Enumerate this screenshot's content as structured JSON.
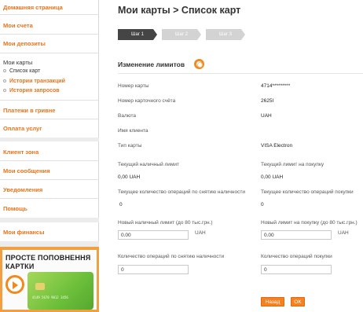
{
  "sidebar": {
    "home": "Домашняя страница",
    "accounts": "Мои счета",
    "deposits": "Мои депозиты",
    "cards_current": "Мои карты",
    "cards_sub": [
      "Список карт",
      "Истории транзакций",
      "История запросов"
    ],
    "payments": "Платежи в гривне",
    "services": "Оплата услуг",
    "client_zone": "Клиент зона",
    "messages": "Мои сообщения",
    "notifications": "Уведомления",
    "help": "Помощь",
    "finances": "Мои финансы"
  },
  "promo": {
    "title": "ПРОСТЕ ПОПОВНЕННЯ КАРТКИ",
    "card_number": "4149 5678 9012 3456"
  },
  "header": {
    "title": "Мои карты > Список карт",
    "steps": [
      "Шаг 1",
      "Шаг 2",
      "Шаг 3"
    ]
  },
  "section": {
    "title": "Изменение лимитов",
    "icon": "lifebuoy-icon"
  },
  "details": [
    {
      "label": "Номер карты",
      "value": "4714*********"
    },
    {
      "label": "Номер карточного счёта",
      "value": "2625I"
    },
    {
      "label": "Валюта",
      "value": "UAH"
    },
    {
      "label": "Имя клиента",
      "value": ""
    },
    {
      "label": "Тип карты",
      "value": "VISA Electron"
    }
  ],
  "limits": {
    "cash_limit_label": "Текущий наличный лимит",
    "cash_limit_value": "0,00 UAH",
    "purchase_limit_label": "Текущий лимит на покупку",
    "purchase_limit_value": "0,00 UAH",
    "cash_ops_label": "Текущее количество операций по снятию наличности",
    "cash_ops_value": "0",
    "purchase_ops_label": "Текущее количество операций покупки",
    "purchase_ops_value": "0",
    "new_cash_label": "Новый наличный лимит (до 80 тыс.грн.)",
    "new_cash_value": "0.00",
    "new_purchase_label": "Новый лимит на покупку (до 80 тыс.грн.)",
    "new_purchase_value": "0.00",
    "currency_unit": "UAH",
    "cash_ops_count_label": "Количество операций по снятию наличности",
    "cash_ops_count_value": "0",
    "purchase_ops_count_label": "Количество операций покупки",
    "purchase_ops_count_value": "0"
  },
  "actions": {
    "back": "Назад",
    "ok": "OK"
  },
  "colors": {
    "accent": "#e8731a",
    "button": "#f58220"
  }
}
